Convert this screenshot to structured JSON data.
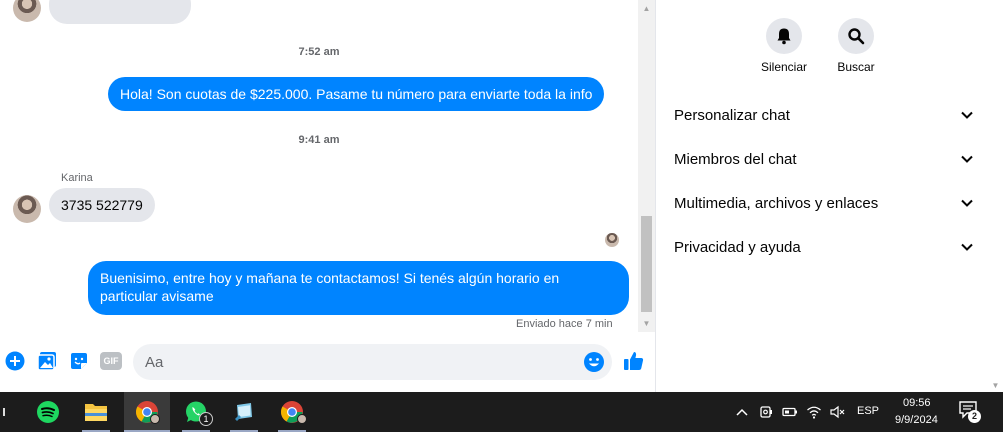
{
  "chat": {
    "timestamps": [
      "7:52 am",
      "9:41 am"
    ],
    "sender_name": "Karina",
    "messages": {
      "top_partial": "",
      "out_1": "Hola! Son cuotas de $225.000. Pasame tu número para enviarte toda la info",
      "in_1": "3735 522779",
      "out_2_line1": "Buenisimo, entre hoy y mañana te contactamos! Si tenés algún horario en",
      "out_2_line2": "particular avisame"
    },
    "status": "Enviado hace 7 min"
  },
  "composer": {
    "placeholder": "Aa",
    "value": "",
    "gif_label": "GIF"
  },
  "panel": {
    "actions": [
      {
        "label": "Silenciar",
        "icon": "bell-icon"
      },
      {
        "label": "Buscar",
        "icon": "search-icon"
      }
    ],
    "sections": [
      "Personalizar chat",
      "Miembros del chat",
      "Multimedia, archivos y enlaces",
      "Privacidad y ayuda"
    ]
  },
  "taskbar": {
    "language": "ESP",
    "time": "09:56",
    "date": "9/9/2024",
    "whatsapp_badge": "1",
    "notification_count": "2"
  },
  "colors": {
    "accent": "#0084ff",
    "bubble_in": "#e4e6eb",
    "taskbar": "#1c1c1c"
  }
}
